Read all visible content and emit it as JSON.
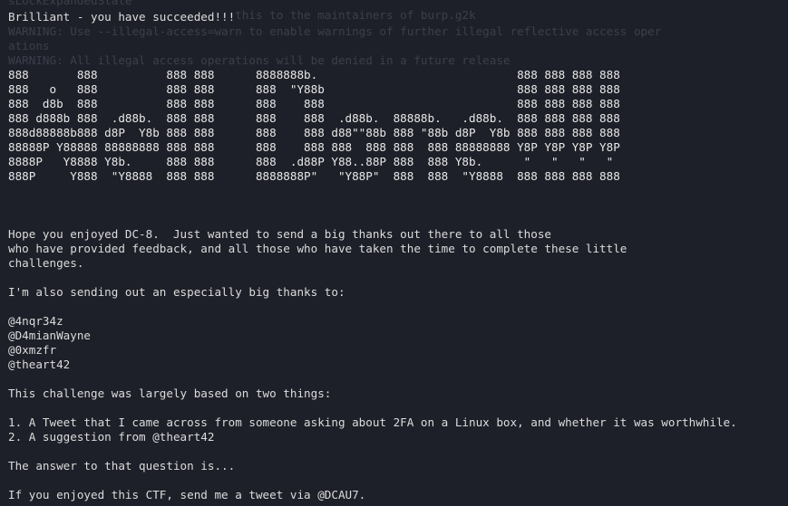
{
  "background_lines": [
    "sLockExpandedState",
    "                                 this to the maintainers of burp.g2k",
    "WARNING: Use --illegal-access=warn to enable warnings of further illegal reflective access oper",
    "ations",
    "WARNING: All illegal access operations will be denied in a future release"
  ],
  "success_message": "Brilliant - you have succeeded!!!",
  "ascii_banner": [
    "888       888          888 888      8888888b.                             888 888 888 888",
    "888   o   888          888 888      888  \"Y88b                            888 888 888 888",
    "888  d8b  888          888 888      888    888                            888 888 888 888",
    "888 d888b 888  .d88b.  888 888      888    888  .d88b.  88888b.   .d88b.  888 888 888 888",
    "888d88888b888 d8P  Y8b 888 888      888    888 d88\"\"88b 888 \"88b d8P  Y8b 888 888 888 888",
    "88888P Y88888 88888888 888 888      888    888 888  888 888  888 88888888 Y8P Y8P Y8P Y8P",
    "8888P   Y8888 Y8b.     888 888      888  .d88P Y88..88P 888  888 Y8b.      \"   \"   \"   \"",
    "888P     Y888  \"Y8888  888 888      8888888P\"   \"Y88P\"  888  888  \"Y8888  888 888 888 888"
  ],
  "message_lines": [
    "Hope you enjoyed DC-8.  Just wanted to send a big thanks out there to all those",
    "who have provided feedback, and all those who have taken the time to complete these little",
    "challenges.",
    "",
    "I'm also sending out an especially big thanks to:",
    "",
    "@4nqr34z",
    "@D4mianWayne",
    "@0xmzfr",
    "@theart42",
    "",
    "This challenge was largely based on two things:",
    "",
    "1. A Tweet that I came across from someone asking about 2FA on a Linux box, and whether it was worthwhile.",
    "2. A suggestion from @theart42",
    "",
    "The answer to that question is...",
    "",
    "If you enjoyed this CTF, send me a tweet via @DCAU7."
  ],
  "colors": {
    "background": "#1e2029",
    "text": "#dcdcdc",
    "faded_text": "#3b3f4a"
  }
}
